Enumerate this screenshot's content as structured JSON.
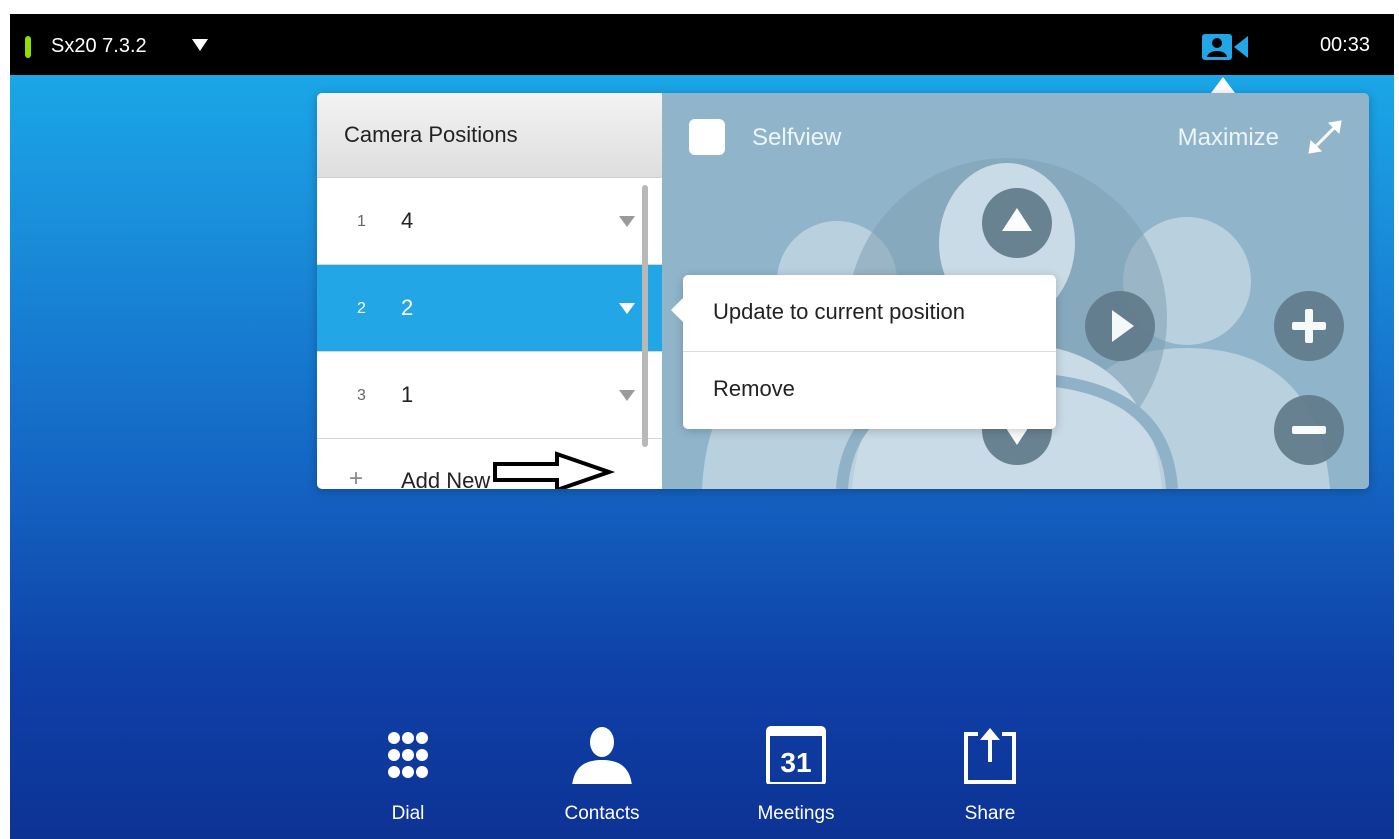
{
  "topbar": {
    "device_name": "Sx20 7.3.2",
    "clock": "00:33"
  },
  "positions_panel": {
    "title": "Camera Positions",
    "rows": [
      {
        "index": "1",
        "name": "4",
        "selected": false
      },
      {
        "index": "2",
        "name": "2",
        "selected": true
      },
      {
        "index": "3",
        "name": "1",
        "selected": false
      }
    ],
    "add_new_label": "Add New"
  },
  "camera_view": {
    "selfview_label": "Selfview",
    "maximize_label": "Maximize"
  },
  "context_menu": {
    "items": [
      "Update to current position",
      "Remove"
    ]
  },
  "dock": {
    "items": [
      {
        "label": "Dial",
        "icon": "dialpad-icon"
      },
      {
        "label": "Contacts",
        "icon": "contacts-icon"
      },
      {
        "label": "Meetings",
        "icon": "calendar-icon",
        "icon_text": "31"
      },
      {
        "label": "Share",
        "icon": "share-icon"
      }
    ]
  },
  "colors": {
    "accent": "#22a6e6",
    "status_led": "#8fe000",
    "camera_indicator": "#22a6e6",
    "topbar": "#000000"
  }
}
